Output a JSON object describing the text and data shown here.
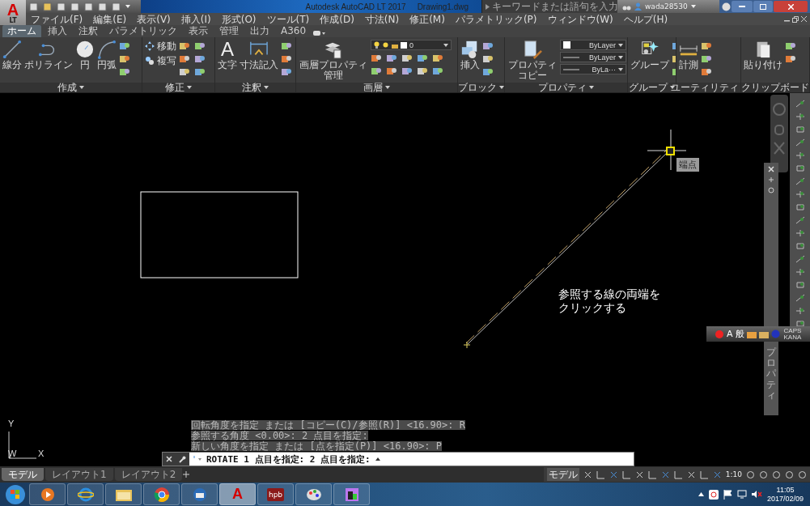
{
  "title_bar": {
    "app_button": {
      "letter": "A",
      "edition": "LT"
    },
    "title": "Autodesk AutoCAD LT 2017",
    "document": "Drawing1.dwg",
    "search": {
      "placeholder": "キーワードまたは語句を入力"
    },
    "user": "wada28530"
  },
  "menu": [
    "ファイル(F)",
    "編集(E)",
    "表示(V)",
    "挿入(I)",
    "形式(O)",
    "ツール(T)",
    "作成(D)",
    "寸法(N)",
    "修正(M)",
    "パラメトリック(P)",
    "ウィンドウ(W)",
    "ヘルプ(H)"
  ],
  "ribbon_tabs": [
    {
      "label": "ホーム",
      "selected": true
    },
    {
      "label": "挿入",
      "selected": false
    },
    {
      "label": "注釈",
      "selected": false
    },
    {
      "label": "パラメトリック",
      "selected": false
    },
    {
      "label": "表示",
      "selected": false
    },
    {
      "label": "管理",
      "selected": false
    },
    {
      "label": "出力",
      "selected": false
    },
    {
      "label": "A360",
      "selected": false
    }
  ],
  "panels": [
    {
      "title": "作成",
      "tools": [
        {
          "kind": "line",
          "label": "線分"
        },
        {
          "kind": "polyline",
          "label": "ポリライン"
        },
        {
          "kind": "circle",
          "label": "円"
        },
        {
          "kind": "arc",
          "label": "円弧"
        }
      ]
    },
    {
      "title": "修正",
      "tools": [
        {
          "kind": "move",
          "label": "移動"
        },
        {
          "kind": "copy",
          "label": "複写"
        }
      ]
    },
    {
      "title": "注釈",
      "tools": [
        {
          "kind": "text",
          "glyph": "A",
          "label": "文字"
        },
        {
          "kind": "dimension",
          "label": "寸法記入"
        }
      ]
    },
    {
      "title": "画層",
      "tools": [
        {
          "kind": "layers",
          "label": "画層プロパティ管理"
        }
      ],
      "layer": "0"
    },
    {
      "title": "ブロック",
      "tools": [
        {
          "kind": "insert",
          "label": "挿入"
        }
      ]
    },
    {
      "title": "プロパティ",
      "tools": [
        {
          "kind": "match",
          "label": "プロパティコピー"
        }
      ],
      "dropdowns": [
        "ByLayer",
        "ByLayer",
        "ByLa···"
      ]
    },
    {
      "title": "グループ",
      "tools": [
        {
          "kind": "group",
          "label": "グループ"
        }
      ]
    },
    {
      "title": "ユーティリティ",
      "tools": [
        {
          "kind": "measure",
          "label": "計測"
        }
      ]
    },
    {
      "title": "クリップボード",
      "tools": [
        {
          "kind": "paste",
          "label": "貼り付け"
        }
      ]
    }
  ],
  "canvas": {
    "annotation": [
      "参照する線の両端を",
      "クリックする"
    ],
    "tooltip": "端点",
    "ucs": {
      "y": "Y",
      "origin": "W",
      "x": "X"
    }
  },
  "properties_palette": {
    "title": "プロパティ"
  },
  "ime_bar": {
    "mode": "A",
    "dictionary": "般",
    "caps": "CAPS",
    "kana": "KANA"
  },
  "command": {
    "history": [
      "回転角度を指定 または [コピー(C)/参照(R)] <16.90>: R",
      "参照する角度 <0.00>:  2 点目を指定:",
      "新しい角度を指定 または [点を指定(P)] <16.90>: P"
    ],
    "prompt": "ROTATE 1 点目を指定:  2 点目を指定:"
  },
  "layout_tabs": [
    {
      "label": "モデル",
      "selected": true
    },
    {
      "label": "レイアウト1",
      "selected": false
    },
    {
      "label": "レイアウト2",
      "selected": false
    }
  ],
  "status_bar": {
    "space": "モデル",
    "scale": "1:10"
  },
  "taskbar": {
    "apps": [
      {
        "kind": "media",
        "active": false
      },
      {
        "kind": "browser",
        "active": false
      },
      {
        "kind": "folder",
        "active": false
      },
      {
        "kind": "chrome",
        "active": false
      },
      {
        "kind": "mail",
        "active": false
      },
      {
        "kind": "autocad",
        "letter": "A",
        "active": true
      },
      {
        "kind": "hpb",
        "label": "hpb",
        "active": false
      },
      {
        "kind": "paint",
        "active": false
      },
      {
        "kind": "tool",
        "active": false
      }
    ],
    "time": "11:05",
    "date": "2017/02/09"
  }
}
